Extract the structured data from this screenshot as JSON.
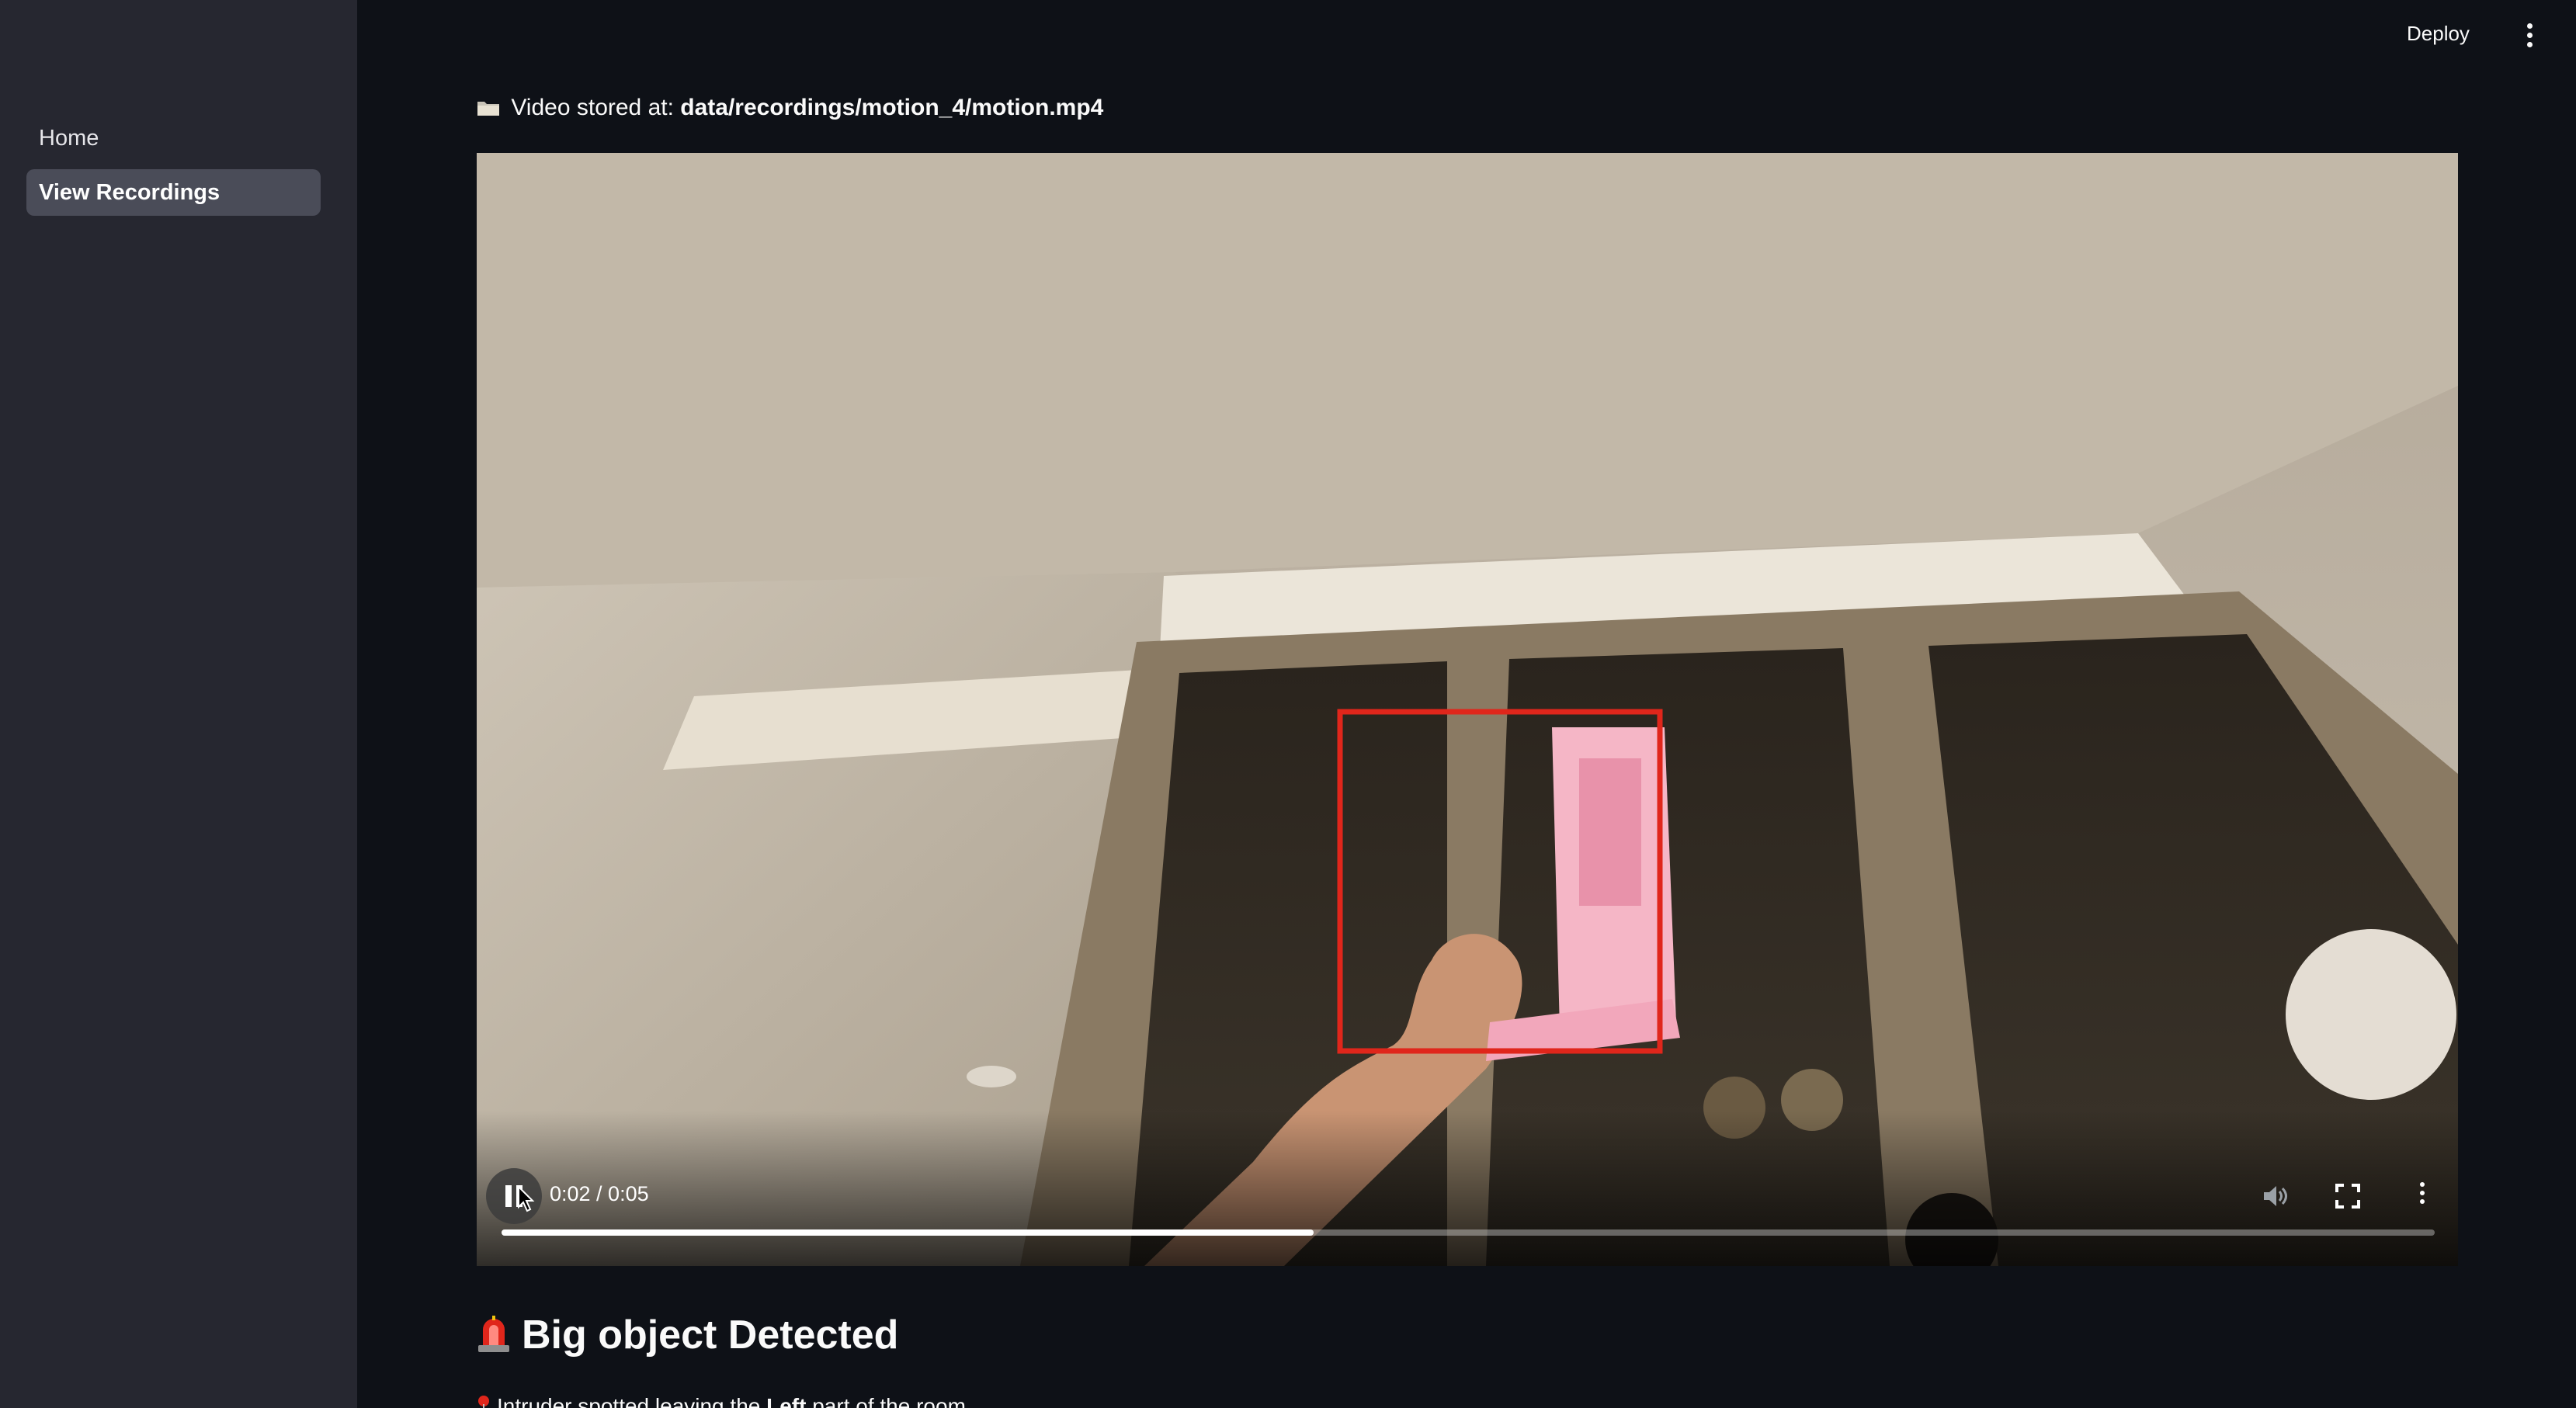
{
  "header": {
    "deploy_label": "Deploy"
  },
  "sidebar": {
    "items": [
      {
        "label": "Home",
        "active": false
      },
      {
        "label": "View Recordings",
        "active": true
      }
    ]
  },
  "main": {
    "storage_prefix": "Video stored at:",
    "storage_path": "data/recordings/motion_4/motion.mp4",
    "video": {
      "current_time": "0:02",
      "duration": "0:05",
      "time_display": "0:02 / 0:05",
      "progress": 0.42,
      "state": "playing"
    },
    "alert_heading": "Big object Detected",
    "alert_detail_prefix": "Intruder spotted leaving the ",
    "alert_detail_bold": "Left",
    "alert_detail_suffix": " part of the room"
  },
  "colors": {
    "background": "#0e1117",
    "sidebar": "#262730",
    "detection_box": "#e0261b",
    "active_nav": "#4a4c58"
  },
  "icons": [
    "folder-icon",
    "pause-icon",
    "mute-icon",
    "fullscreen-icon",
    "more-options-icon",
    "siren-icon",
    "pin-icon"
  ]
}
